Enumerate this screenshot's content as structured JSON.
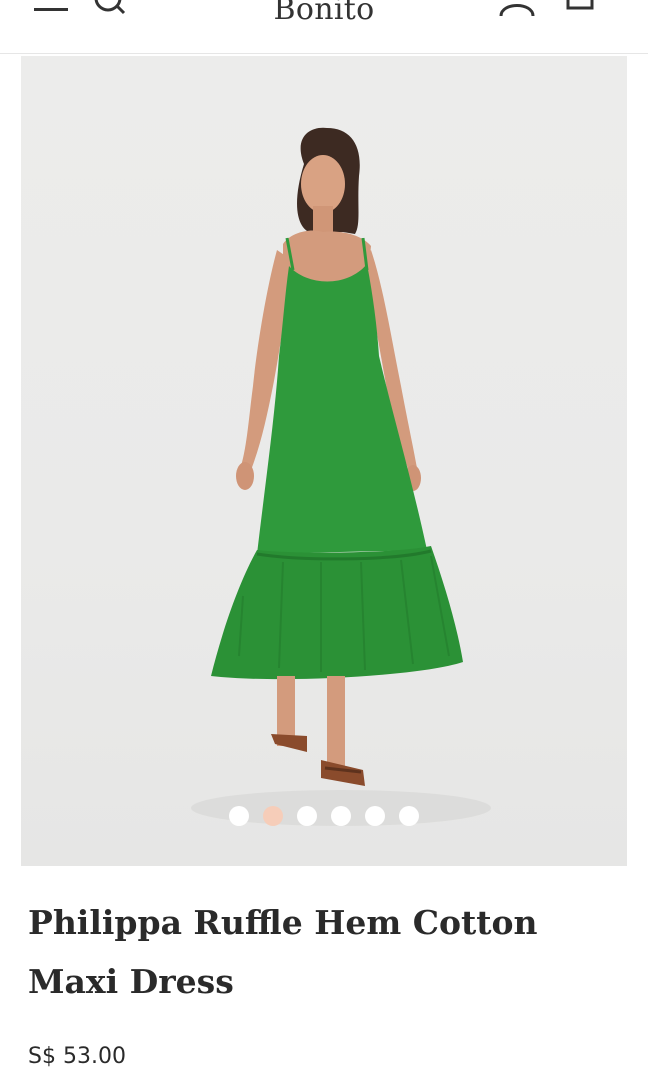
{
  "header": {
    "brand": "Bonito",
    "icons": {
      "menu": "menu-icon",
      "search": "search-icon",
      "account": "user-icon",
      "cart": "bag-icon"
    }
  },
  "gallery": {
    "image": "green-maxi-dress-photo",
    "slide_count": 6,
    "active_slide": 2
  },
  "product": {
    "title": "Philippa Ruffle Hem Cotton Maxi Dress",
    "price": "S$ 53.00"
  },
  "colors": {
    "dress_green": "#2f9a3c",
    "active_dot": "#f6cdb9",
    "background": "#ebebea"
  }
}
